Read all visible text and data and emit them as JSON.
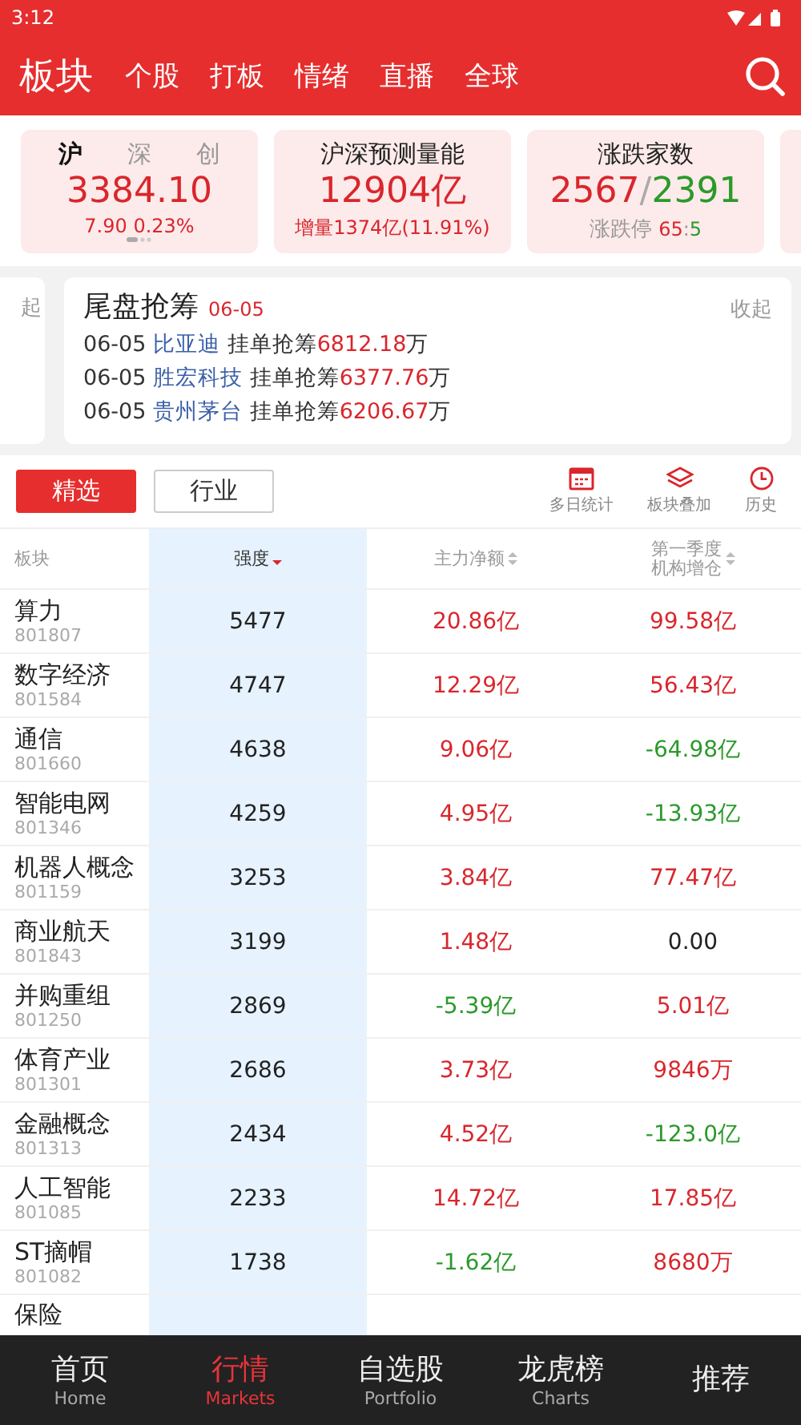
{
  "status_bar": {
    "time": "3:12"
  },
  "top_tabs": [
    {
      "label": "板块",
      "selected": true
    },
    {
      "label": "个股",
      "selected": false
    },
    {
      "label": "打板",
      "selected": false
    },
    {
      "label": "情绪",
      "selected": false
    },
    {
      "label": "直播",
      "selected": false
    },
    {
      "label": "全球",
      "selected": false
    }
  ],
  "index_card": {
    "tabs": [
      {
        "label": "沪",
        "selected": true
      },
      {
        "label": "深",
        "selected": false
      },
      {
        "label": "创",
        "selected": false
      }
    ],
    "value": "3384.10",
    "change": "7.90",
    "percent": "0.23%"
  },
  "volume_card": {
    "title": "沪深预测量能",
    "value": "12904亿",
    "detail": "增量1374亿(11.91%)"
  },
  "breadth_card": {
    "title": "涨跌家数",
    "up": "2567",
    "separator": "/",
    "down": "2391",
    "limit_label": "涨跌停",
    "limit_up": "65",
    "limit_sep": ":",
    "limit_down": "5"
  },
  "prev_card": {
    "text": "起"
  },
  "auction_card": {
    "title": "尾盘抢筹",
    "date": "06-05",
    "collapse": "收起",
    "items": [
      {
        "date": "06-05",
        "stock": "比亚迪",
        "label": "挂单抢筹",
        "amount": "6812.18",
        "unit": "万"
      },
      {
        "date": "06-05",
        "stock": "胜宏科技",
        "label": "挂单抢筹",
        "amount": "6377.76",
        "unit": "万"
      },
      {
        "date": "06-05",
        "stock": "贵州茅台",
        "label": "挂单抢筹",
        "amount": "6206.67",
        "unit": "万"
      }
    ]
  },
  "segments": [
    {
      "label": "精选",
      "selected": true
    },
    {
      "label": "行业",
      "selected": false
    }
  ],
  "tools": [
    {
      "kind": "calendar",
      "label": "多日统计"
    },
    {
      "kind": "layers",
      "label": "板块叠加"
    },
    {
      "kind": "clock",
      "label": "历史"
    }
  ],
  "table": {
    "columns": [
      {
        "label": "板块",
        "sortable": false,
        "selected": false
      },
      {
        "label": "强度",
        "sortable": true,
        "selected": true
      },
      {
        "label": "主力净额",
        "sortable": true,
        "selected": false
      },
      {
        "label": "第一季度机构增仓",
        "sortable": true,
        "selected": false
      }
    ],
    "rows": [
      {
        "name": "算力",
        "code": "801807",
        "strength": "5477",
        "net": {
          "text": "20.86亿",
          "kind": "up"
        },
        "inst": {
          "text": "99.58亿",
          "kind": "up"
        }
      },
      {
        "name": "数字经济",
        "code": "801584",
        "strength": "4747",
        "net": {
          "text": "12.29亿",
          "kind": "up"
        },
        "inst": {
          "text": "56.43亿",
          "kind": "up"
        }
      },
      {
        "name": "通信",
        "code": "801660",
        "strength": "4638",
        "net": {
          "text": "9.06亿",
          "kind": "up"
        },
        "inst": {
          "text": "-64.98亿",
          "kind": "down"
        }
      },
      {
        "name": "智能电网",
        "code": "801346",
        "strength": "4259",
        "net": {
          "text": "4.95亿",
          "kind": "up"
        },
        "inst": {
          "text": "-13.93亿",
          "kind": "down"
        }
      },
      {
        "name": "机器人概念",
        "code": "801159",
        "strength": "3253",
        "net": {
          "text": "3.84亿",
          "kind": "up"
        },
        "inst": {
          "text": "77.47亿",
          "kind": "up"
        }
      },
      {
        "name": "商业航天",
        "code": "801843",
        "strength": "3199",
        "net": {
          "text": "1.48亿",
          "kind": "up"
        },
        "inst": {
          "text": "0.00",
          "kind": "flat"
        }
      },
      {
        "name": "并购重组",
        "code": "801250",
        "strength": "2869",
        "net": {
          "text": "-5.39亿",
          "kind": "down"
        },
        "inst": {
          "text": "5.01亿",
          "kind": "up"
        }
      },
      {
        "name": "体育产业",
        "code": "801301",
        "strength": "2686",
        "net": {
          "text": "3.73亿",
          "kind": "up"
        },
        "inst": {
          "text": "9846万",
          "kind": "up"
        }
      },
      {
        "name": "金融概念",
        "code": "801313",
        "strength": "2434",
        "net": {
          "text": "4.52亿",
          "kind": "up"
        },
        "inst": {
          "text": "-123.0亿",
          "kind": "down"
        }
      },
      {
        "name": "人工智能",
        "code": "801085",
        "strength": "2233",
        "net": {
          "text": "14.72亿",
          "kind": "up"
        },
        "inst": {
          "text": "17.85亿",
          "kind": "up"
        }
      },
      {
        "name": "ST摘帽",
        "code": "801082",
        "strength": "1738",
        "net": {
          "text": "-1.62亿",
          "kind": "down"
        },
        "inst": {
          "text": "8680万",
          "kind": "up"
        }
      },
      {
        "name": "保险"
      }
    ]
  },
  "bottom_nav": [
    {
      "label": "首页",
      "sub": "Home",
      "selected": false
    },
    {
      "label": "行情",
      "sub": "Markets",
      "selected": true
    },
    {
      "label": "自选股",
      "sub": "Portfolio",
      "selected": false
    },
    {
      "label": "龙虎榜",
      "sub": "Charts",
      "selected": false
    },
    {
      "label": "推荐",
      "selected": false
    }
  ]
}
